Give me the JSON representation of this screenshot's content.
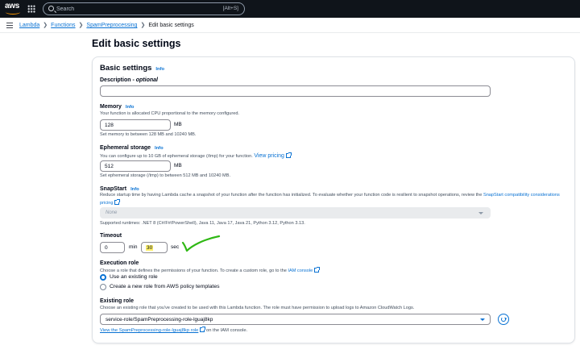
{
  "topnav": {
    "logo_text": "aws",
    "search": {
      "placeholder": "Search",
      "shortcut": "[Alt+S]"
    }
  },
  "breadcrumb": {
    "items": [
      "Lambda",
      "Functions",
      "SpamPreprocessing"
    ],
    "current": "Edit basic settings"
  },
  "page_title": "Edit basic settings",
  "panel": {
    "title": "Basic settings",
    "info_label": "Info",
    "description": {
      "label": "Description",
      "optional": "optional",
      "value": ""
    },
    "memory": {
      "label": "Memory",
      "desc": "Your function is allocated CPU proportional to the memory configured.",
      "value": "128",
      "unit": "MB",
      "hint": "Set memory to between 128 MB and 10240 MB."
    },
    "ephemeral": {
      "label": "Ephemeral storage",
      "desc": "You can configure up to 10 GB of ephemeral storage (/tmp) for your function.",
      "link": "View pricing",
      "value": "512",
      "unit": "MB",
      "hint": "Set ephemeral storage (/tmp) to between 512 MB and 10240 MB."
    },
    "snapstart": {
      "label": "SnapStart",
      "desc_1": "Reduce startup time by having Lambda cache a snapshot of your function after the function has initialized. To evaluate whether your function code is resilient to snapshot operations, review the",
      "link_1": "SnapStart compatibility considerations",
      "link_2": "pricing",
      "value": "None",
      "hint": "Supported runtimes: .NET 8 (C#/F#/PowerShell), Java 11, Java 17, Java 21, Python 3.12, Python 3.13."
    },
    "timeout": {
      "label": "Timeout",
      "min_value": "0",
      "min_unit": "min",
      "sec_value": "30",
      "sec_unit": "sec"
    },
    "execution_role": {
      "label": "Execution role",
      "desc": "Choose a role that defines the permissions of your function. To create a custom role, go to the",
      "link": "IAM console",
      "options": [
        "Use an existing role",
        "Create a new role from AWS policy templates"
      ],
      "selected_index": 0
    },
    "existing_role": {
      "label": "Existing role",
      "desc": "Choose an existing role that you've created to be used with this Lambda function. The role must have permission to upload logs to Amazon CloudWatch Logs.",
      "value": "service-role/SpamPreprocessing-role-lguaj8kp",
      "view_link": "View the SpamPreprocessing-role-lguaj8kp role",
      "view_suffix": "on the IAM console."
    }
  },
  "colors": {
    "nav_bg": "#0f141a",
    "link": "#0972d3",
    "highlight": "#fff16b",
    "checkmark": "#2fb814"
  }
}
